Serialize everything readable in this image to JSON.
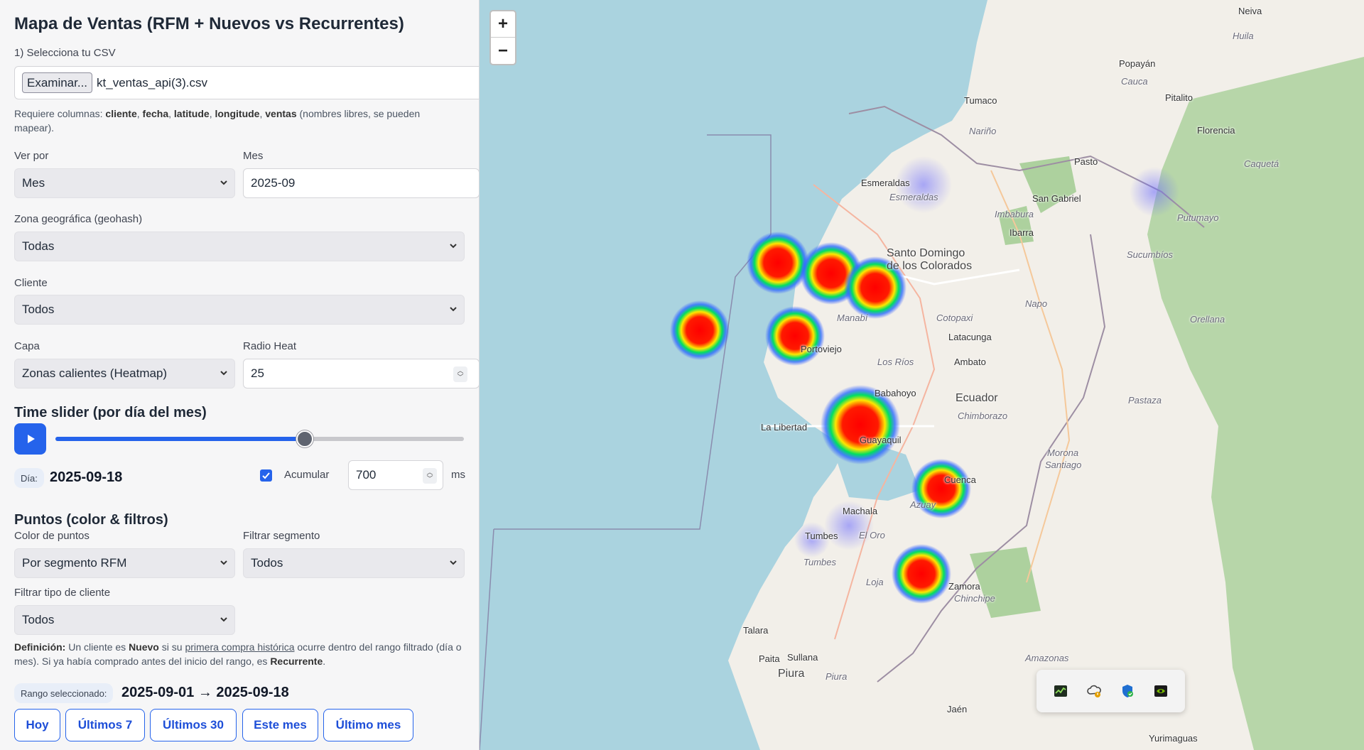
{
  "title": "Mapa de Ventas (RFM + Nuevos vs Recurrentes)",
  "file": {
    "label": "1) Selecciona tu CSV",
    "button": "Examinar...",
    "filename": "kt_ventas_api(3).csv",
    "req_prefix": "Requiere columnas:",
    "req_cols": [
      "cliente",
      "fecha",
      "latitude",
      "longitude",
      "ventas"
    ],
    "req_suffix": "(nombres libres, se pueden mapear)."
  },
  "view": {
    "label": "Ver por",
    "value": "Mes"
  },
  "month": {
    "label": "Mes",
    "value": "2025-09"
  },
  "zone": {
    "label": "Zona geográfica (geohash)",
    "value": "Todas"
  },
  "client": {
    "label": "Cliente",
    "value": "Todos"
  },
  "layer": {
    "label": "Capa",
    "value": "Zonas calientes (Heatmap)"
  },
  "radius": {
    "label": "Radio Heat",
    "value": "25"
  },
  "slider": {
    "title": "Time slider (por día del mes)",
    "progress": 0.61,
    "day_chip": "Día:",
    "day_value": "2025-09-18",
    "accumulate_label": "Acumular",
    "accumulate_checked": true,
    "speed_value": "700",
    "speed_unit": "ms"
  },
  "points": {
    "title": "Puntos (color & filtros)",
    "color_label": "Color de puntos",
    "color_value": "Por segmento RFM",
    "segment_label": "Filtrar segmento",
    "segment_value": "Todos",
    "type_label": "Filtrar tipo de cliente",
    "type_value": "Todos"
  },
  "definition": {
    "label": "Definición:",
    "t1": "Un cliente es",
    "nuevo": "Nuevo",
    "t2": "si su",
    "link": "primera compra histórica",
    "t3": "ocurre dentro del rango filtrado (día o mes). Si ya había comprado antes del inicio del rango, es",
    "recurrente": "Recurrente",
    "t4": "."
  },
  "range": {
    "chip": "Rango seleccionado:",
    "value": "2025-09-01 → 2025-09-18"
  },
  "quick_buttons": [
    "Hoy",
    "Últimos 7",
    "Últimos 30",
    "Este mes",
    "Último mes"
  ],
  "map": {
    "zoom_in": "+",
    "zoom_out": "−",
    "labels": [
      {
        "text": "Neiva",
        "kind": "city"
      },
      {
        "text": "Huila",
        "kind": "region"
      },
      {
        "text": "Popayán",
        "kind": "city"
      },
      {
        "text": "Cauca",
        "kind": "region"
      },
      {
        "text": "Pitalito",
        "kind": "city"
      },
      {
        "text": "Tumaco",
        "kind": "city"
      },
      {
        "text": "Nariño",
        "kind": "region"
      },
      {
        "text": "Florencia",
        "kind": "city"
      },
      {
        "text": "Pasto",
        "kind": "city"
      },
      {
        "text": "Caquetá",
        "kind": "region"
      },
      {
        "text": "Esmeraldas",
        "kind": "city"
      },
      {
        "text": "Esmeraldas",
        "kind": "region"
      },
      {
        "text": "San Gabriel",
        "kind": "city"
      },
      {
        "text": "Imbabura",
        "kind": "region"
      },
      {
        "text": "Putumayo",
        "kind": "region"
      },
      {
        "text": "Ibarra",
        "kind": "city"
      },
      {
        "text": "Sucumbíos",
        "kind": "region"
      },
      {
        "text": "Santo Domingo",
        "kind": "city"
      },
      {
        "text": "de los Colorados",
        "kind": "city"
      },
      {
        "text": "Napo",
        "kind": "region"
      },
      {
        "text": "Orellana",
        "kind": "region"
      },
      {
        "text": "Manabí",
        "kind": "region"
      },
      {
        "text": "Cotopaxi",
        "kind": "region"
      },
      {
        "text": "Latacunga",
        "kind": "city"
      },
      {
        "text": "Portoviejo",
        "kind": "city"
      },
      {
        "text": "Los Ríos",
        "kind": "region"
      },
      {
        "text": "Ambato",
        "kind": "city"
      },
      {
        "text": "Babahoyo",
        "kind": "city"
      },
      {
        "text": "Ecuador",
        "kind": "country"
      },
      {
        "text": "Pastaza",
        "kind": "region"
      },
      {
        "text": "Chimborazo",
        "kind": "region"
      },
      {
        "text": "La Libertad",
        "kind": "city"
      },
      {
        "text": "Guayaquil",
        "kind": "city"
      },
      {
        "text": "Morona",
        "kind": "region"
      },
      {
        "text": "Santiago",
        "kind": "region"
      },
      {
        "text": "Cuenca",
        "kind": "city"
      },
      {
        "text": "Azuay",
        "kind": "region"
      },
      {
        "text": "Machala",
        "kind": "city"
      },
      {
        "text": "Tumbes",
        "kind": "city"
      },
      {
        "text": "El Oro",
        "kind": "region"
      },
      {
        "text": "Tumbes",
        "kind": "region"
      },
      {
        "text": "Loja",
        "kind": "region"
      },
      {
        "text": "Zamora",
        "kind": "city"
      },
      {
        "text": "Chinchipe",
        "kind": "region"
      },
      {
        "text": "Talara",
        "kind": "city"
      },
      {
        "text": "Paita",
        "kind": "city"
      },
      {
        "text": "Sullana",
        "kind": "city"
      },
      {
        "text": "Amazonas",
        "kind": "region"
      },
      {
        "text": "Piura",
        "kind": "city"
      },
      {
        "text": "Piura",
        "kind": "region"
      },
      {
        "text": "Jaén",
        "kind": "city"
      },
      {
        "text": "Yurimaguas",
        "kind": "city"
      }
    ]
  },
  "tray_icons": [
    "gpu-monitor-icon",
    "cloud-warning-icon",
    "security-shield-icon",
    "nvidia-icon"
  ],
  "colors": {
    "accent": "#2563eb",
    "water": "#aad3df",
    "land": "#f2efe9",
    "forest": "#add19e"
  }
}
